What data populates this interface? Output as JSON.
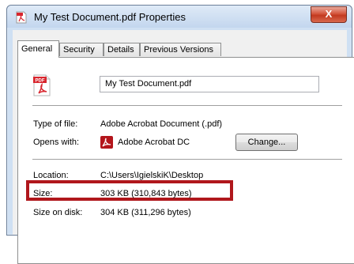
{
  "window": {
    "title": "My Test Document.pdf Properties",
    "close_label": "X"
  },
  "tabs": [
    {
      "label": "General",
      "active": true
    },
    {
      "label": "Security",
      "active": false
    },
    {
      "label": "Details",
      "active": false
    },
    {
      "label": "Previous Versions",
      "active": false
    }
  ],
  "general": {
    "file_name": "My Test Document.pdf",
    "pdf_icon_text": "PDF",
    "type_label": "Type of file:",
    "type_value": "Adobe Acrobat Document (.pdf)",
    "opens_label": "Opens with:",
    "opens_value": "Adobe Acrobat DC",
    "change_button": "Change...",
    "location_label": "Location:",
    "location_value": "C:\\Users\\IgielskiK\\Desktop",
    "size_label": "Size:",
    "size_value": "303 KB (310,843 bytes)",
    "size_on_disk_label": "Size on disk:",
    "size_on_disk_value": "304 KB (311,296 bytes)"
  },
  "colors": {
    "highlight_box": "#b0171c",
    "pdf_red": "#d8262e"
  }
}
